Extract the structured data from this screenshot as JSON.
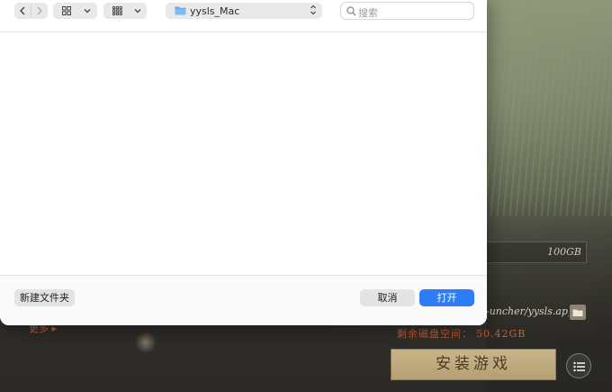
{
  "dialog": {
    "nav": {
      "back_icon": "chevron-left-icon",
      "forward_icon": "chevron-right-icon"
    },
    "view_mode_icon": "grid-icon",
    "group_icon": "group-grid-icon",
    "location": {
      "icon": "folder-icon",
      "label": "yysls_Mac"
    },
    "search": {
      "icon": "search-icon",
      "placeholder": "搜索"
    },
    "buttons": {
      "new_folder": "新建文件夹",
      "cancel": "取消",
      "open": "打开"
    }
  },
  "background": {
    "size_value": "100GB",
    "install_path": "-uncher/yysls.app",
    "disk_label": "剩余磁盘空间：",
    "disk_value": "50.42GB",
    "install_button": "安装游戏",
    "more_link": "更多 ▸"
  },
  "colors": {
    "accent": "#2e7cf6",
    "disk_text": "#c6633b",
    "install_bg": "#c9b58a"
  }
}
